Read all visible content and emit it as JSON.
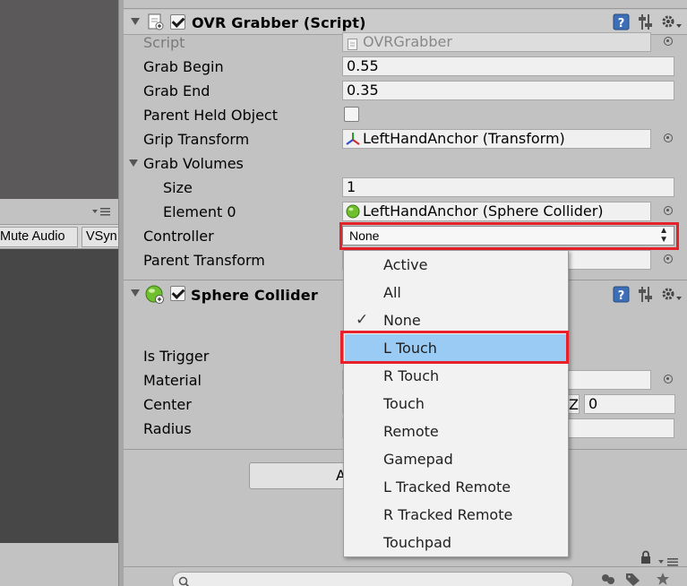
{
  "left_pane": {
    "mute_audio_label": "Mute Audio",
    "vsync_label": "VSyn"
  },
  "ovr_grabber": {
    "title": "OVR Grabber (Script)",
    "enabled": true,
    "fields": {
      "script_label": "Script",
      "script_value": "OVRGrabber",
      "grab_begin_label": "Grab Begin",
      "grab_begin_value": "0.55",
      "grab_end_label": "Grab End",
      "grab_end_value": "0.35",
      "parent_held_object_label": "Parent Held Object",
      "parent_held_object_checked": false,
      "grip_transform_label": "Grip Transform",
      "grip_transform_value": "LeftHandAnchor (Transform)",
      "grab_volumes_label": "Grab Volumes",
      "size_label": "Size",
      "size_value": "1",
      "element0_label": "Element 0",
      "element0_value": "LeftHandAnchor (Sphere Collider)",
      "controller_label": "Controller",
      "controller_value": "None",
      "parent_transform_label": "Parent Transform"
    }
  },
  "sphere_collider": {
    "title": "Sphere Collider",
    "enabled": true,
    "fields": {
      "is_trigger_label": "Is Trigger",
      "material_label": "Material",
      "center_label": "Center",
      "center_z_label": "Z",
      "center_z_value": "0",
      "radius_label": "Radius"
    }
  },
  "add_component_partial": "A",
  "dropdown": {
    "options": [
      "Active",
      "All",
      "None",
      "L Touch",
      "R Touch",
      "Touch",
      "Remote",
      "Gamepad",
      "L Tracked Remote",
      "R Tracked Remote",
      "Touchpad"
    ],
    "checked_option": "None",
    "highlighted_option": "L Touch"
  },
  "colors": {
    "highlight_blue": "#99cbf5",
    "annotation_red": "#e8202a"
  },
  "icons": [
    "script-icon",
    "help-icon",
    "presets-icon",
    "gear-icon",
    "target-icon",
    "transform-icon",
    "sphere-collider-icon",
    "lock-icon",
    "menu-icon",
    "search-icon",
    "layers-icon",
    "star-icon",
    "tag-icon"
  ]
}
